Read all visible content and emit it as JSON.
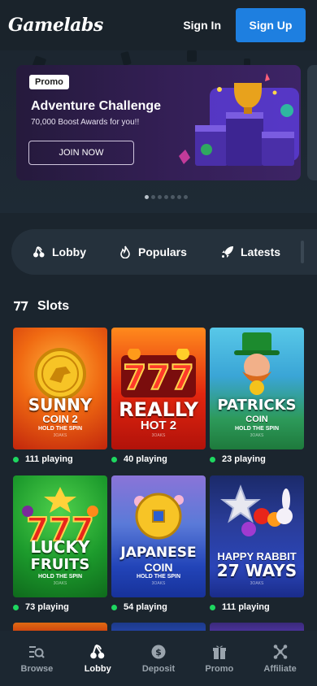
{
  "header": {
    "logo_text": "Gamelabs",
    "signin_label": "Sign In",
    "signup_label": "Sign Up",
    "accent_color": "#1e7fe0"
  },
  "banner": {
    "tag": "Promo",
    "title": "Adventure Challenge",
    "subtitle": "70,000 Boost Awards for you!!",
    "cta_label": "JOIN NOW",
    "active_slide": 1,
    "slide_count": 7
  },
  "categories": {
    "items": [
      {
        "label": "Lobby",
        "icon": "cherries-icon"
      },
      {
        "label": "Populars",
        "icon": "flame-icon"
      },
      {
        "label": "Latests",
        "icon": "rocket-icon"
      }
    ]
  },
  "slots": {
    "title": "Slots",
    "icon": "seven-seven-icon",
    "games": [
      {
        "line1": "SUNNY",
        "line2": "COIN 2",
        "line3": "HOLD THE SPIN",
        "studio": "3OAKS",
        "playing": "111 playing"
      },
      {
        "line1": "REALLY",
        "line2": "HOT 2",
        "line3": "",
        "studio": "3OAKS",
        "playing": "40 playing"
      },
      {
        "line1": "PATRICKS",
        "line2": "COIN",
        "line3": "HOLD THE SPIN",
        "studio": "3OAKS",
        "playing": "23 playing"
      },
      {
        "line1": "LUCKY",
        "line2": "FRUITS",
        "line3": "HOLD THE SPIN",
        "studio": "3OAKS",
        "playing": "73 playing"
      },
      {
        "line1": "JAPANESE",
        "line2": "COIN",
        "line3": "HOLD THE SPIN",
        "studio": "3OAKS",
        "playing": "54 playing"
      },
      {
        "line1": "HAPPY RABBIT",
        "line2": "27 WAYS",
        "line3": "",
        "studio": "3OAKS",
        "playing": "111 playing"
      }
    ],
    "status_color": "#1ed760"
  },
  "bottom_nav": {
    "items": [
      {
        "label": "Browse",
        "icon": "browse-search-icon",
        "active": false
      },
      {
        "label": "Lobby",
        "icon": "cherries-icon",
        "active": true
      },
      {
        "label": "Deposit",
        "icon": "coin-deposit-icon",
        "active": false
      },
      {
        "label": "Promo",
        "icon": "gift-icon",
        "active": false
      },
      {
        "label": "Affiliate",
        "icon": "network-icon",
        "active": false
      }
    ]
  }
}
